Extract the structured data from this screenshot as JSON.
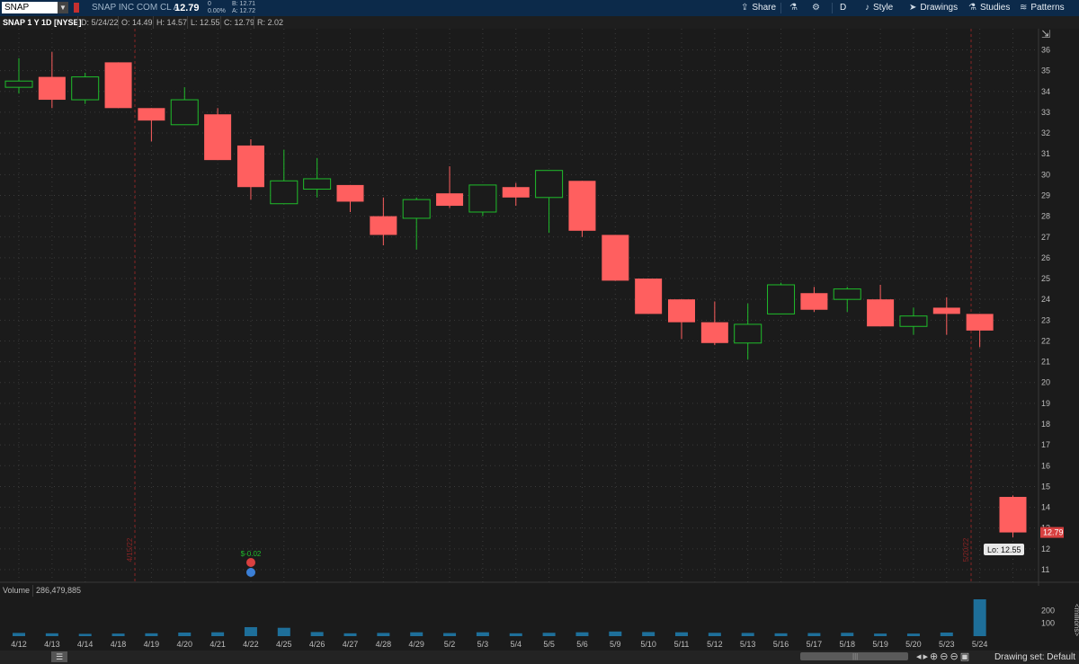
{
  "toolbar": {
    "symbol": "SNAP",
    "company": "SNAP INC COM CL A",
    "last": "12.79",
    "change": "0",
    "change_pct": "0.00%",
    "bid": "B: 12.71",
    "ask": "A: 12.72",
    "share": "Share",
    "time_frame": "D",
    "style": "Style",
    "drawings": "Drawings",
    "studies": "Studies",
    "patterns": "Patterns"
  },
  "info": {
    "title": "SNAP 1 Y 1D [NYSE]",
    "date": "D: 5/24/22",
    "open": "O: 14.49",
    "high": "H: 14.57",
    "low": "L: 12.55",
    "close": "C: 12.79",
    "range": "R: 2.02"
  },
  "volume": {
    "label": "Volume",
    "value": "286,479,885"
  },
  "bottom": {
    "drawing_set": "Drawing set: Default"
  },
  "chart_data": {
    "type": "candlestick",
    "price_axis": {
      "min": 11,
      "max": 36,
      "ticks": [
        11,
        12,
        13,
        14,
        15,
        16,
        17,
        18,
        19,
        20,
        21,
        22,
        23,
        24,
        25,
        26,
        27,
        28,
        29,
        30,
        31,
        32,
        33,
        34,
        35,
        36
      ]
    },
    "volume_axis": {
      "unit": "millions",
      "ticks": [
        100,
        200
      ]
    },
    "categories": [
      "4/12",
      "4/13",
      "4/14",
      "4/18",
      "4/19",
      "4/20",
      "4/21",
      "4/22",
      "4/25",
      "4/26",
      "4/27",
      "4/28",
      "4/29",
      "5/2",
      "5/3",
      "5/4",
      "5/5",
      "5/6",
      "5/9",
      "5/10",
      "5/11",
      "5/12",
      "5/13",
      "5/16",
      "5/17",
      "5/18",
      "5/19",
      "5/20",
      "5/23",
      "5/24"
    ],
    "candles": [
      {
        "o": 34.2,
        "h": 35.6,
        "l": 33.9,
        "c": 34.5
      },
      {
        "o": 34.7,
        "h": 35.9,
        "l": 33.2,
        "c": 33.6
      },
      {
        "o": 33.6,
        "h": 34.9,
        "l": 33.4,
        "c": 34.7
      },
      {
        "o": 35.4,
        "h": 35.4,
        "l": 33.2,
        "c": 33.2
      },
      {
        "o": 33.2,
        "h": 33.2,
        "l": 31.6,
        "c": 32.6
      },
      {
        "o": 32.4,
        "h": 34.2,
        "l": 32.4,
        "c": 33.6
      },
      {
        "o": 32.9,
        "h": 33.2,
        "l": 30.7,
        "c": 30.7
      },
      {
        "o": 31.4,
        "h": 31.7,
        "l": 28.8,
        "c": 29.4
      },
      {
        "o": 28.6,
        "h": 31.2,
        "l": 28.6,
        "c": 29.7
      },
      {
        "o": 29.3,
        "h": 30.8,
        "l": 28.9,
        "c": 29.8
      },
      {
        "o": 29.5,
        "h": 29.5,
        "l": 28.2,
        "c": 28.7
      },
      {
        "o": 28.0,
        "h": 28.9,
        "l": 26.6,
        "c": 27.1
      },
      {
        "o": 27.9,
        "h": 28.9,
        "l": 26.4,
        "c": 28.8
      },
      {
        "o": 29.1,
        "h": 30.4,
        "l": 28.4,
        "c": 28.5
      },
      {
        "o": 28.2,
        "h": 29.5,
        "l": 28.0,
        "c": 29.5
      },
      {
        "o": 29.4,
        "h": 29.6,
        "l": 28.5,
        "c": 28.9
      },
      {
        "o": 28.9,
        "h": 30.2,
        "l": 27.2,
        "c": 30.2
      },
      {
        "o": 29.7,
        "h": 29.7,
        "l": 27.0,
        "c": 27.3
      },
      {
        "o": 27.1,
        "h": 27.1,
        "l": 24.9,
        "c": 24.9
      },
      {
        "o": 25.0,
        "h": 25.0,
        "l": 23.3,
        "c": 23.3
      },
      {
        "o": 24.0,
        "h": 24.0,
        "l": 22.1,
        "c": 22.9
      },
      {
        "o": 22.9,
        "h": 23.9,
        "l": 21.8,
        "c": 21.9
      },
      {
        "o": 21.9,
        "h": 23.8,
        "l": 21.1,
        "c": 22.8
      },
      {
        "o": 23.3,
        "h": 24.8,
        "l": 23.3,
        "c": 24.7
      },
      {
        "o": 24.3,
        "h": 24.6,
        "l": 23.4,
        "c": 23.5
      },
      {
        "o": 24.0,
        "h": 24.6,
        "l": 23.4,
        "c": 24.5
      },
      {
        "o": 24.0,
        "h": 24.7,
        "l": 22.7,
        "c": 22.7
      },
      {
        "o": 22.7,
        "h": 23.6,
        "l": 22.3,
        "c": 23.2
      },
      {
        "o": 23.6,
        "h": 24.1,
        "l": 22.3,
        "c": 23.3
      },
      {
        "o": 23.3,
        "h": 23.3,
        "l": 21.7,
        "c": 22.5
      },
      {
        "o": 14.5,
        "h": 14.57,
        "l": 12.55,
        "c": 12.79
      }
    ],
    "volumes_millions": [
      25,
      22,
      18,
      20,
      22,
      28,
      30,
      70,
      65,
      32,
      22,
      25,
      30,
      24,
      30,
      22,
      26,
      30,
      36,
      32,
      30,
      26,
      25,
      22,
      24,
      26,
      20,
      20,
      28,
      286.5
    ],
    "markers": [
      {
        "label": "4/15/22",
        "type": "event-line"
      },
      {
        "label": "5/20/22",
        "type": "event-line"
      }
    ],
    "earnings": {
      "label": "$-0.02"
    },
    "current_price_label": "12.79",
    "low_label": "Lo: 12.55",
    "volume_axis_label": "<millions>",
    "colors": {
      "up": "#1fbd2b",
      "down": "#ff5f5f",
      "grid": "#3a3a3a",
      "background": "#1b1b1b",
      "volume": "#1e6f9a",
      "event": "#8a2424"
    }
  }
}
